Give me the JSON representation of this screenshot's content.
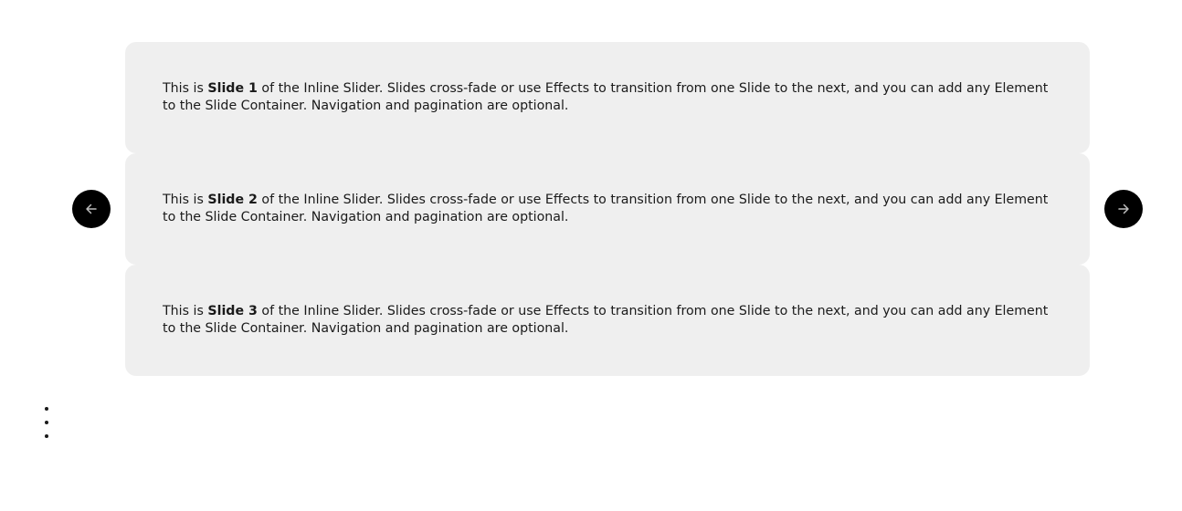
{
  "slider": {
    "slides": [
      {
        "prefix": "This is ",
        "strong": "Slide 1",
        "suffix": " of the Inline Slider. Slides cross-fade or use Effects to transition from one Slide to the next, and you can add any Element to the Slide Container. Navigation and pagination are optional."
      },
      {
        "prefix": "This is ",
        "strong": "Slide 2",
        "suffix": " of the Inline Slider. Slides cross-fade or use Effects to transition from one Slide to the next, and you can add any Element to the Slide Container. Navigation and pagination are optional."
      },
      {
        "prefix": "This is ",
        "strong": "Slide 3",
        "suffix": " of the Inline Slider. Slides cross-fade or use Effects to transition from one Slide to the next, and you can add any Element to the Slide Container. Navigation and pagination are optional."
      }
    ]
  },
  "navigation": {
    "prev_icon": "arrow-left-icon",
    "next_icon": "arrow-right-icon"
  },
  "menu": {
    "icon": "more-vertical-icon"
  },
  "colors": {
    "slide_background": "#efefef",
    "nav_button_background": "#000000",
    "text": "#1a1a1a",
    "arrow": "#bdbdbd"
  }
}
